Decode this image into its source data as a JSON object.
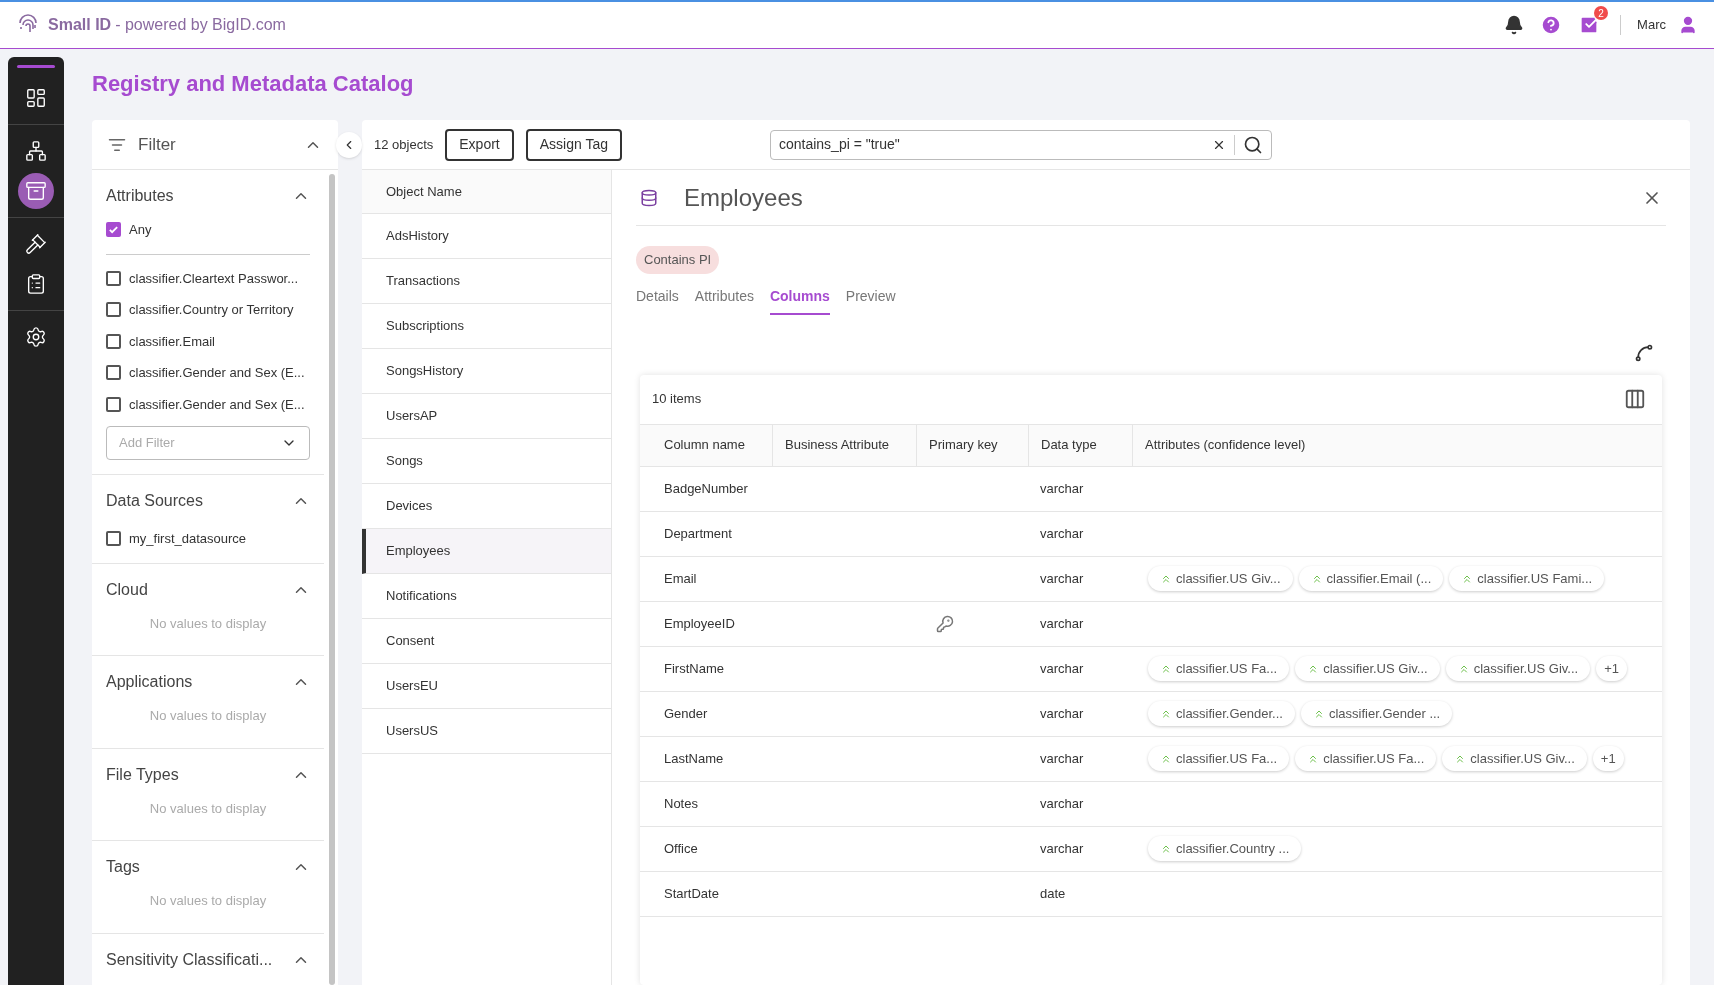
{
  "header": {
    "brand": "Small ID",
    "tagline": "- powered by BigID.com",
    "notification_count": "2",
    "user": "Marc"
  },
  "nav_groups": [
    [
      {
        "selected": false
      }
    ],
    [
      {
        "selected": false
      },
      {
        "selected": true
      }
    ],
    [
      {
        "selected": false
      },
      {
        "selected": false
      }
    ],
    [
      {
        "selected": false
      }
    ]
  ],
  "page_title": "Registry and Metadata Catalog",
  "filter": {
    "title": "Filter",
    "sections": [
      {
        "kind": "attributes",
        "title": "Attributes",
        "any": {
          "label": "Any",
          "checked": true
        },
        "options": [
          {
            "label": "classifier.Cleartext Passwor...",
            "checked": false
          },
          {
            "label": "classifier.Country or Territory",
            "checked": false
          },
          {
            "label": "classifier.Email",
            "checked": false
          },
          {
            "label": "classifier.Gender and Sex (E...",
            "checked": false
          },
          {
            "label": "classifier.Gender and Sex (E...",
            "checked": false
          }
        ],
        "add_filter_placeholder": "Add Filter"
      },
      {
        "kind": "options",
        "title": "Data Sources",
        "options": [
          {
            "label": "my_first_datasource",
            "checked": false
          }
        ]
      },
      {
        "kind": "empty",
        "title": "Cloud",
        "message": "No values to display"
      },
      {
        "kind": "empty",
        "title": "Applications",
        "message": "No values to display"
      },
      {
        "kind": "empty",
        "title": "File Types",
        "message": "No values to display"
      },
      {
        "kind": "empty",
        "title": "Tags",
        "message": "No values to display"
      },
      {
        "kind": "empty",
        "title": "Sensitivity Classificati..."
      }
    ]
  },
  "toolbar": {
    "count": "12 objects",
    "buttons": [
      "Export",
      "Assign Tag"
    ],
    "query": "contains_pi = \"true\""
  },
  "objects": {
    "header": "Object Name",
    "items": [
      {
        "name": "AdsHistory",
        "selected": false
      },
      {
        "name": "Transactions",
        "selected": false
      },
      {
        "name": "Subscriptions",
        "selected": false
      },
      {
        "name": "SongsHistory",
        "selected": false
      },
      {
        "name": "UsersAP",
        "selected": false
      },
      {
        "name": "Songs",
        "selected": false
      },
      {
        "name": "Devices",
        "selected": false
      },
      {
        "name": "Employees",
        "selected": true
      },
      {
        "name": "Notifications",
        "selected": false
      },
      {
        "name": "Consent",
        "selected": false
      },
      {
        "name": "UsersEU",
        "selected": false
      },
      {
        "name": "UsersUS",
        "selected": false
      }
    ]
  },
  "detail": {
    "title": "Employees",
    "tag": "Contains PI",
    "tabs": [
      {
        "label": "Details",
        "selected": false
      },
      {
        "label": "Attributes",
        "selected": false
      },
      {
        "label": "Columns",
        "selected": true
      },
      {
        "label": "Preview",
        "selected": false
      }
    ],
    "table": {
      "count": "10 items",
      "columns": [
        "Column name",
        "Business Attribute",
        "Primary key",
        "Data type",
        "Attributes (confidence level)"
      ],
      "rows": [
        {
          "name": "BadgeNumber",
          "primary_key": false,
          "data_type": "varchar",
          "attributes": []
        },
        {
          "name": "Department",
          "primary_key": false,
          "data_type": "varchar",
          "attributes": []
        },
        {
          "name": "Email",
          "primary_key": false,
          "data_type": "varchar",
          "attributes": [
            "classifier.US Giv...",
            "classifier.Email (...",
            "classifier.US Fami..."
          ]
        },
        {
          "name": "EmployeeID",
          "primary_key": true,
          "data_type": "varchar",
          "attributes": []
        },
        {
          "name": "FirstName",
          "primary_key": false,
          "data_type": "varchar",
          "attributes": [
            "classifier.US Fa...",
            "classifier.US Giv...",
            "classifier.US Giv..."
          ],
          "more": "+1"
        },
        {
          "name": "Gender",
          "primary_key": false,
          "data_type": "varchar",
          "attributes": [
            "classifier.Gender...",
            "classifier.Gender ..."
          ]
        },
        {
          "name": "LastName",
          "primary_key": false,
          "data_type": "varchar",
          "attributes": [
            "classifier.US Fa...",
            "classifier.US Fa...",
            "classifier.US Giv..."
          ],
          "more": "+1"
        },
        {
          "name": "Notes",
          "primary_key": false,
          "data_type": "varchar",
          "attributes": []
        },
        {
          "name": "Office",
          "primary_key": false,
          "data_type": "varchar",
          "attributes": [
            "classifier.Country ..."
          ]
        },
        {
          "name": "StartDate",
          "primary_key": false,
          "data_type": "date",
          "attributes": []
        }
      ]
    }
  }
}
